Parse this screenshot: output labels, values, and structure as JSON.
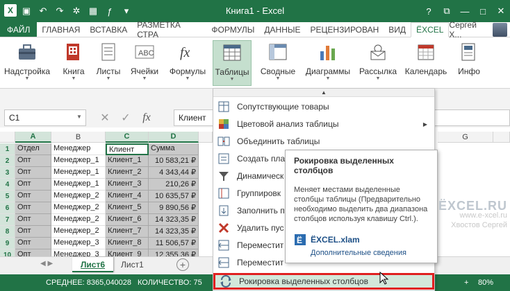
{
  "window": {
    "title": "Книга1 - Excel"
  },
  "tabs": [
    "ФАЙЛ",
    "ГЛАВНАЯ",
    "ВСТАВКА",
    "РАЗМЕТКА СТРА",
    "ФОРМУЛЫ",
    "ДАННЫЕ",
    "РЕЦЕНЗИРОВАН",
    "ВИД",
    "ЁXCEL"
  ],
  "user": "Сергей Х...",
  "ribbon": [
    {
      "label": "Надстройка",
      "icon": "toolbox-icon"
    },
    {
      "label": "Книга",
      "icon": "workbook-icon"
    },
    {
      "label": "Листы",
      "icon": "sheets-icon"
    },
    {
      "label": "Ячейки",
      "icon": "cells-icon"
    },
    {
      "label": "Формулы",
      "icon": "fx-icon"
    },
    {
      "label": "Таблицы",
      "icon": "table-icon"
    },
    {
      "label": "Сводные",
      "icon": "pivot-icon"
    },
    {
      "label": "Диаграммы",
      "icon": "chart-icon"
    },
    {
      "label": "Рассылка",
      "icon": "mail-icon"
    },
    {
      "label": "Календарь",
      "icon": "calendar-icon"
    },
    {
      "label": "Инфо",
      "icon": "info-icon"
    }
  ],
  "formula": {
    "namebox": "C1",
    "value": "Клиент",
    "fx": "fx"
  },
  "columns": [
    "A",
    "B",
    "C",
    "D"
  ],
  "rows": [
    {
      "n": "1",
      "a": "Отдел",
      "b": "Менеджер",
      "c": "Клиент",
      "d": "Сумма"
    },
    {
      "n": "2",
      "a": "Опт",
      "b": "Менеджер_1",
      "c": "Клиент_1",
      "d": "10 583,21 ₽"
    },
    {
      "n": "3",
      "a": "Опт",
      "b": "Менеджер_1",
      "c": "Клиент_2",
      "d": "4 343,44 ₽"
    },
    {
      "n": "4",
      "a": "Опт",
      "b": "Менеджер_1",
      "c": "Клиент_3",
      "d": "210,26 ₽"
    },
    {
      "n": "5",
      "a": "Опт",
      "b": "Менеджер_2",
      "c": "Клиент_4",
      "d": "10 635,57 ₽"
    },
    {
      "n": "6",
      "a": "Опт",
      "b": "Менеджер_2",
      "c": "Клиент_5",
      "d": "9 890,56 ₽"
    },
    {
      "n": "7",
      "a": "Опт",
      "b": "Менеджер_2",
      "c": "Клиент_6",
      "d": "14 323,35 ₽"
    },
    {
      "n": "8",
      "a": "Опт",
      "b": "Менеджер_2",
      "c": "Клиент_7",
      "d": "14 323,35 ₽"
    },
    {
      "n": "9",
      "a": "Опт",
      "b": "Менеджер_3",
      "c": "Клиент_8",
      "d": "11 506,57 ₽"
    },
    {
      "n": "10",
      "a": "Опт",
      "b": "Менеджер_3",
      "c": "Клиент_9",
      "d": "12 355,36 ₽"
    }
  ],
  "far_column": "G",
  "sheets": [
    "Лист6",
    "Лист1"
  ],
  "status": {
    "avg": "СРЕДНЕЕ: 8365,040028",
    "count": "КОЛИЧЕСТВО: 75",
    "zoom": "80%"
  },
  "menu": [
    {
      "label": "Сопутствующие товары",
      "icon": "grid-icon"
    },
    {
      "label": "Цветовой анализ таблицы",
      "icon": "color-grid-icon",
      "sub": true
    },
    {
      "label": "Объединить таблицы",
      "icon": "merge-icon"
    },
    {
      "label": "Создать пла",
      "icon": "plan-icon"
    },
    {
      "label": "Динамическ",
      "icon": "filter-icon"
    },
    {
      "label": "Группировк",
      "icon": "group-icon"
    },
    {
      "label": "Заполнить п",
      "icon": "fill-icon"
    },
    {
      "label": "Удалить пус",
      "icon": "delete-icon"
    },
    {
      "label": "Переместит",
      "icon": "move-icon"
    },
    {
      "label": "Переместит",
      "icon": "move-icon"
    },
    {
      "label": "Рокировка выделенных столбцов",
      "icon": "swap-icon"
    }
  ],
  "tooltip": {
    "title": "Рокировка выделенных столбцов",
    "text": "Меняет местами выделенные столбцы таблицы (Предварительно необходимо выделить два диапазона столбцов используя клавишу Ctrl.).",
    "addin": "ЁXCEL.xlam",
    "more": "Дополнительные сведения"
  },
  "watermark": {
    "brand": "ЁXCEL.RU",
    "url": "www.e-xcel.ru",
    "author": "Хвостов Сергей"
  }
}
